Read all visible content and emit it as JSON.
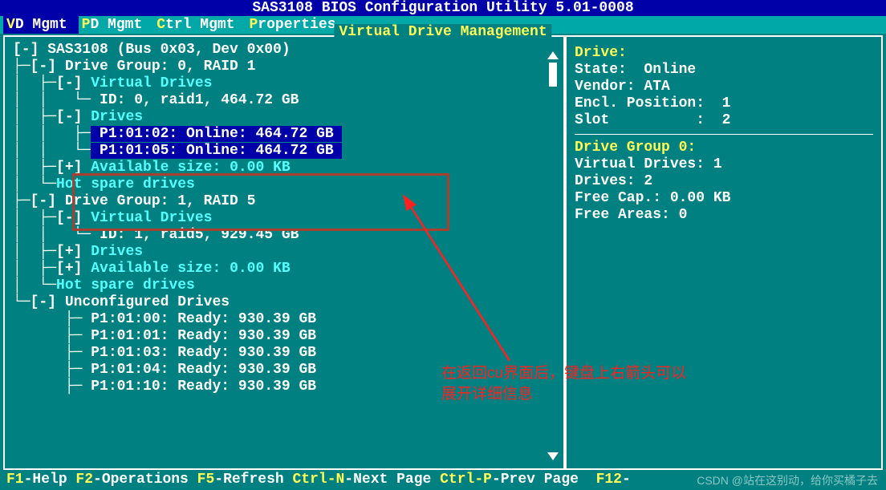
{
  "title": "SAS3108 BIOS Configuration Utility 5.01-0008",
  "menu": {
    "vd_mgmt_hot": "V",
    "vd_mgmt": "D Mgmt",
    "pd_mgmt_hot": "P",
    "pd_mgmt": "D Mgmt",
    "ctrl_mgmt_hot": "C",
    "ctrl_mgmt": "trl Mgmt",
    "properties_hot": "P",
    "properties": "roperties"
  },
  "panel_title": "Virtual Drive Management",
  "tree": {
    "l0": "[-] SAS3108 (Bus 0x03, Dev 0x00)",
    "l1": "[-] Drive Group: 0, RAID 1",
    "l2": "[-]",
    "l2b": "Virtual Drives",
    "l3": "ID: 0, raid1, 464.72 GB",
    "l4": "[-]",
    "l4b": "Drives",
    "l5": " P1:01:02: Online: 464.72 GB ",
    "l6": " P1:01:05: Online: 464.72 GB ",
    "l7": "[+]",
    "l7b": "Available size: 0.00 KB",
    "l8": "Hot spare drives",
    "l9": "[-] Drive Group: 1, RAID 5",
    "l10": "[-]",
    "l10b": "Virtual Drives",
    "l11": "ID: 1, raid5, 929.45 GB",
    "l12": "[+]",
    "l12b": "Drives",
    "l13": "[+]",
    "l13b": "Available size: 0.00 KB",
    "l14": "Hot spare drives",
    "l15": "[-] Unconfigured Drives",
    "l16": "P1:01:00: Ready: 930.39 GB",
    "l17": "P1:01:01: Ready: 930.39 GB",
    "l18": "P1:01:03: Ready: 930.39 GB",
    "l19": "P1:01:04: Ready: 930.39 GB",
    "l20": "P1:01:10: Ready: 930.39 GB"
  },
  "info": {
    "h1": "Drive:",
    "state": "State:  Online",
    "vendor": "Vendor: ATA",
    "encl": "Encl. Position:  1",
    "slot": "Slot          :  2",
    "h2": "Drive Group 0:",
    "vd": "Virtual Drives: 1",
    "drv": "Drives: 2",
    "free": "Free Cap.: 0.00 KB",
    "fa": "Free Areas: 0"
  },
  "footer": {
    "f1k": "F1",
    "f1": "-Help ",
    "f2k": "F2",
    "f2": "-Operations ",
    "f5k": "F5",
    "f5": "-Refresh ",
    "cnk": "Ctrl-N",
    "cn": "-Next Page ",
    "cpk": "Ctrl-P",
    "cp": "-Prev Page  ",
    "f12k": "F12",
    "f12": "-"
  },
  "annotation": {
    "line1": "在返回cu界面后，键盘上右箭头可以",
    "line2": "展开详细信息"
  },
  "watermark": "CSDN @站在这别动，给你买橘子去"
}
